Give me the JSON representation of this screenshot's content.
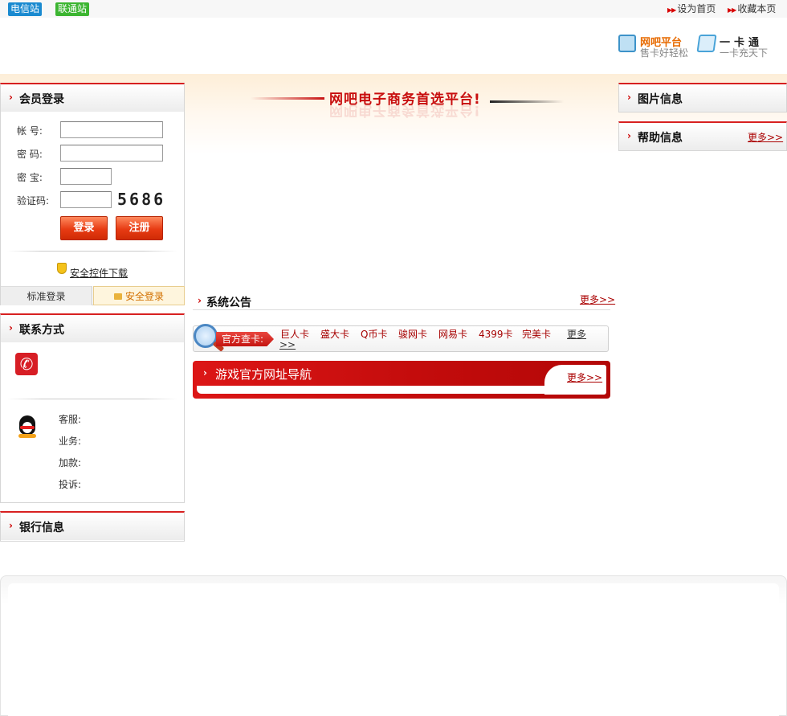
{
  "topbar": {
    "telecom_label": "电信站",
    "unicom_label": "联通站",
    "set_home": "设为首页",
    "bookmark": "收藏本页"
  },
  "header": {
    "netbar_title": "网吧平台",
    "netbar_sub": "售卡好轻松",
    "card_title": "一卡通",
    "card_sub": "一卡充天下"
  },
  "banner": {
    "slogan": "网吧电子商务首选平台!"
  },
  "login": {
    "title": "会员登录",
    "account_label": "帐 号:",
    "password_label": "密 码:",
    "secret_label": "密 宝:",
    "captcha_label": "验证码:",
    "captcha_code": "5686",
    "login_button": "登录",
    "register_button": "注册",
    "security_download": "安全控件下载",
    "tab_standard": "标准登录",
    "tab_secure": "安全登录"
  },
  "contact": {
    "title": "联系方式",
    "rows": [
      "客服:",
      "业务:",
      "加款:",
      "投诉:"
    ]
  },
  "bank": {
    "title": "银行信息"
  },
  "notice": {
    "title": "系统公告",
    "more": "更多>>"
  },
  "card_query": {
    "tag": "官方查卡:",
    "cards": [
      "巨人卡",
      "盛大卡",
      "Q币卡",
      "骏网卡",
      "网易卡",
      "4399卡",
      "完美卡"
    ],
    "more_top": "更多",
    "more_bottom": ">>"
  },
  "game_nav": {
    "title": "游戏官方网址导航",
    "more": "更多>>"
  },
  "right": {
    "pic_title": "图片信息",
    "help_title": "帮助信息",
    "help_more": "更多>>"
  },
  "colors": {
    "accent": "#d72020",
    "brand_orange": "#e76a00"
  }
}
